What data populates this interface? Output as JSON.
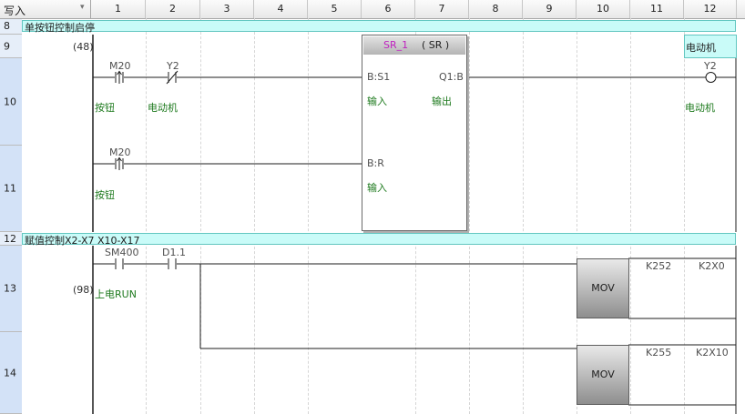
{
  "header": {
    "mode_label": "写入",
    "columns": [
      "1",
      "2",
      "3",
      "4",
      "5",
      "6",
      "7",
      "8",
      "9",
      "10",
      "11",
      "12"
    ]
  },
  "rows": {
    "r8": "8",
    "r9": "9",
    "r10": "10",
    "r11": "11",
    "r12": "12",
    "r13": "13",
    "r14": "14"
  },
  "comments": {
    "row8": "单按钮控制启停",
    "row12": "赋值控制X2-X7 X10-X17"
  },
  "rung1": {
    "step": "(48)",
    "contact1": {
      "device": "M20",
      "comment": "按钮"
    },
    "contact2": {
      "device": "Y2",
      "comment": "电动机"
    },
    "fb": {
      "instance": "SR_1",
      "type": "( SR )",
      "pin_s1": "B:S1",
      "pin_r": "B:R",
      "pin_q1": "Q1:B",
      "s1_comment": "输入",
      "q1_comment": "输出",
      "r_comment": "输入"
    },
    "coil": {
      "device": "Y2",
      "comment": "电动机",
      "label": "电动机"
    },
    "contact3": {
      "device": "M20",
      "comment": "按钮"
    }
  },
  "rung2": {
    "step": "(98)",
    "contact1": {
      "device": "SM400",
      "comment": "上电RUN"
    },
    "contact2": {
      "device": "D1.1"
    },
    "mov1": {
      "name": "MOV",
      "src": "K252",
      "dst": "K2X0"
    },
    "mov2": {
      "name": "MOV",
      "src": "K255",
      "dst": "K2X10"
    }
  }
}
